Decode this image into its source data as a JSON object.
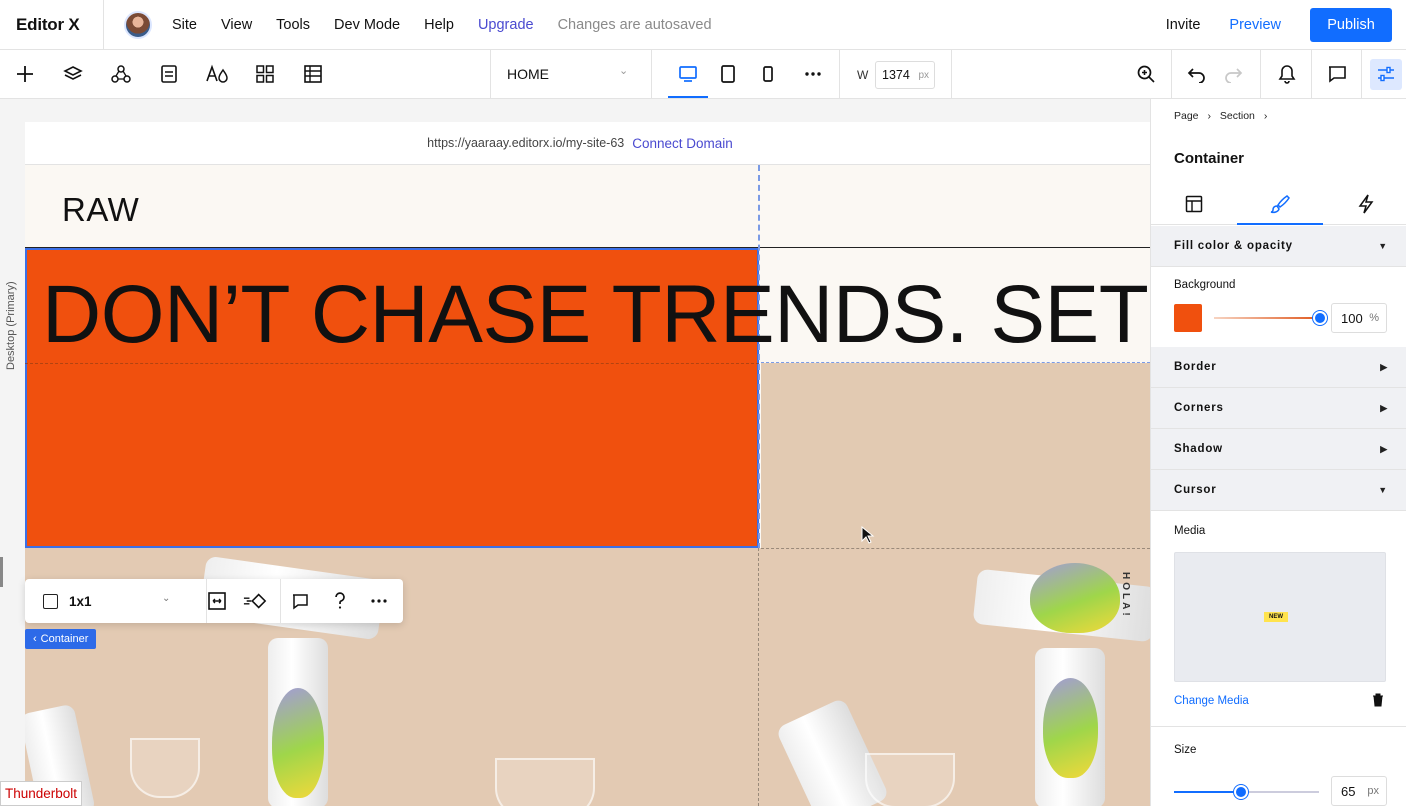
{
  "topbar": {
    "logo": "Editor X",
    "menu": [
      "Site",
      "View",
      "Tools",
      "Dev Mode",
      "Help"
    ],
    "upgrade": "Upgrade",
    "autosave": "Changes are autosaved",
    "invite": "Invite",
    "preview": "Preview",
    "publish": "Publish"
  },
  "toolbar": {
    "page": "HOME",
    "width_label": "W",
    "width_value": "1374",
    "width_unit": "px"
  },
  "left_rail": {
    "label": "Desktop (Primary)"
  },
  "canvas": {
    "url": "https://yaaraay.editorx.io/my-site-63",
    "connect_domain": "Connect Domain",
    "brand": "RAW",
    "headline": "DON’T CHASE TRENDS. SET T",
    "can_text": "HOLA!",
    "context_toolbar": {
      "layout": "1x1"
    },
    "selection_tag": "Container"
  },
  "debug_tag": "Thunderbolt",
  "panel": {
    "breadcrumb": [
      "Page",
      "Section"
    ],
    "title": "Container",
    "sections": {
      "fill": "Fill color & opacity",
      "border": "Border",
      "corners": "Corners",
      "shadow": "Shadow",
      "cursor": "Cursor"
    },
    "background_label": "Background",
    "background_color": "#f0500e",
    "opacity_value": "100",
    "opacity_unit": "%",
    "media_label": "Media",
    "media_badge": "NEW",
    "change_media": "Change Media",
    "size_label": "Size",
    "size_value": "65",
    "size_unit": "px"
  },
  "colors": {
    "accent": "#116dff",
    "orange": "#f0500e",
    "beige": "#e2cab2"
  }
}
